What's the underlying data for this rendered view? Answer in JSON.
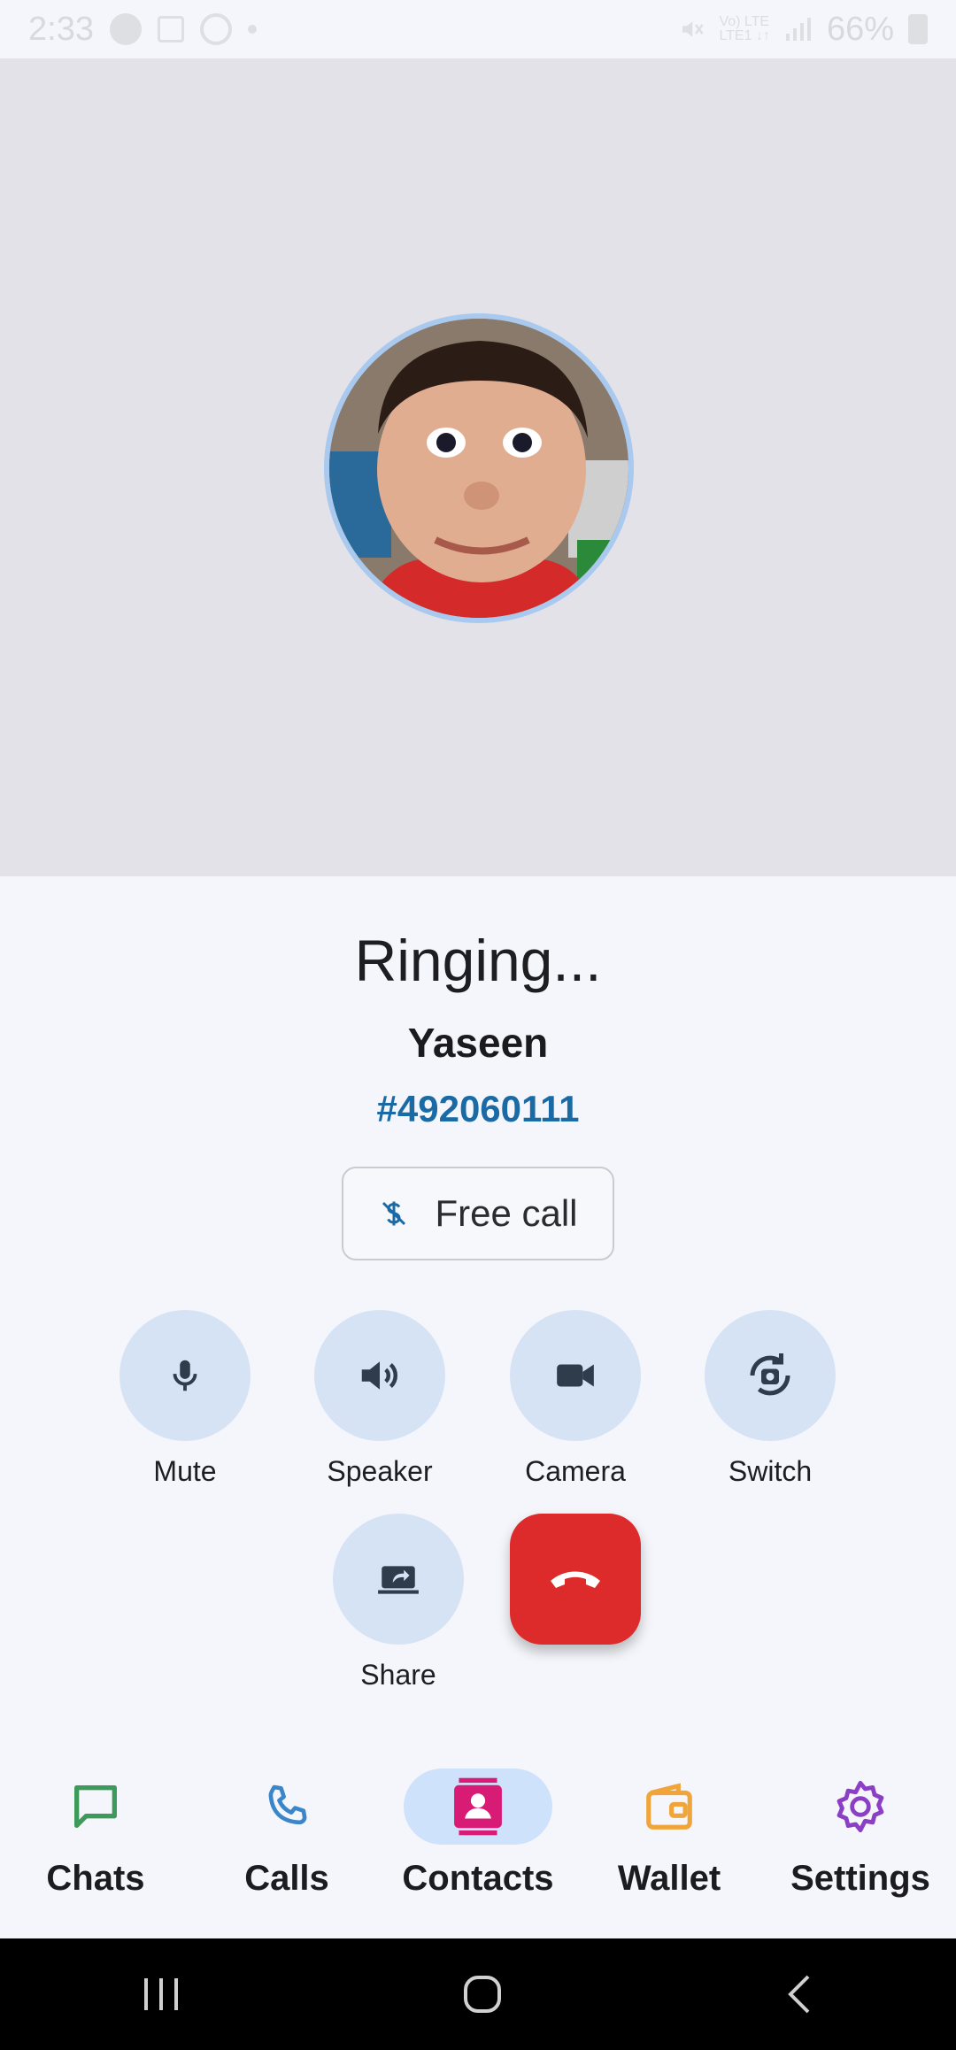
{
  "status_bar": {
    "time": "2:33",
    "battery": "66%",
    "network": "Vo) LTE\nLTE1 ↓↑"
  },
  "call": {
    "status": "Ringing...",
    "caller_name": "Yaseen",
    "caller_id": "#492060111",
    "free_call_label": "Free call"
  },
  "controls": {
    "mute": "Mute",
    "speaker": "Speaker",
    "camera": "Camera",
    "switch": "Switch",
    "share": "Share"
  },
  "bottom_nav": {
    "items": [
      {
        "label": "Chats",
        "icon": "chat-icon",
        "color": "#3d9a5a"
      },
      {
        "label": "Calls",
        "icon": "phone-icon",
        "color": "#3a86c8"
      },
      {
        "label": "Contacts",
        "icon": "contacts-icon",
        "color": "#d81b75",
        "active": true
      },
      {
        "label": "Wallet",
        "icon": "wallet-icon",
        "color": "#f0a53a"
      },
      {
        "label": "Settings",
        "icon": "settings-icon",
        "color": "#8a3fc4"
      }
    ]
  },
  "colors": {
    "accent": "#1a6aa6",
    "hangup": "#dd2a2a",
    "control_bg": "#d6e3f5",
    "nav_active_bg": "#cfe2fb"
  }
}
